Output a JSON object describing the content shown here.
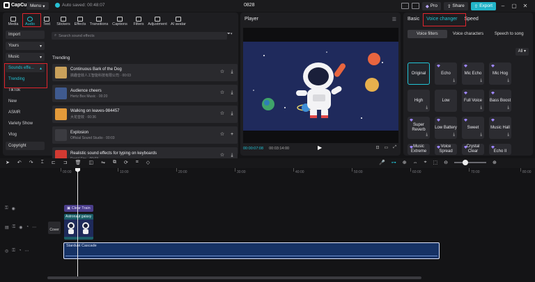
{
  "titlebar": {
    "app_name": "CapCut",
    "menu_label": "Menu",
    "autosave_text": "Auto saved: 00:48:07",
    "project_title": "0828",
    "pro_label": "Pro",
    "share_label": "Share",
    "export_label": "Export"
  },
  "toolbar": {
    "items": [
      {
        "label": "Media",
        "icon": "media-icon"
      },
      {
        "label": "Audio",
        "icon": "audio-icon",
        "active": true
      },
      {
        "label": "Text",
        "icon": "text-icon"
      },
      {
        "label": "Stickers",
        "icon": "sticker-icon"
      },
      {
        "label": "Effects",
        "icon": "effects-icon"
      },
      {
        "label": "Transitions",
        "icon": "transitions-icon"
      },
      {
        "label": "Captions",
        "icon": "captions-icon"
      },
      {
        "label": "Filters",
        "icon": "filters-icon"
      },
      {
        "label": "Adjustment",
        "icon": "adjustment-icon"
      },
      {
        "label": "AI avatar",
        "icon": "ai-avatar-icon"
      }
    ]
  },
  "sidenav": {
    "yours": "Yours",
    "music": "Music",
    "sound_effects": "Sounds effe...",
    "trending": "Trending",
    "tiktok": "TikTok",
    "new": "New",
    "asmr": "ASMR",
    "variety": "Variety Show",
    "vlog": "Vlog",
    "copyright": "Copyright",
    "import": "Import"
  },
  "search": {
    "placeholder": "Search sound effects"
  },
  "section_title": "Trending",
  "sounds": [
    {
      "name": "Continuous Bark of the Dog",
      "meta": "搞趣音效人工智能科技有限公司 · 00:03",
      "color": "#c9a15b"
    },
    {
      "name": "Audience cheers",
      "meta": "Hertz Box Music · 00:20",
      "color": "#3f5a8f"
    },
    {
      "name": "Walking on leaves-984457",
      "meta": "大花音效 · 00:36",
      "color": "#e39a3a"
    },
    {
      "name": "Explosion",
      "meta": "Official Sound Studio · 00:03",
      "color": "#3b3b40"
    },
    {
      "name": "Realistic sound effects for typing on keyboards",
      "meta": "Rapid Fire · 00:03",
      "color": "#d23a32"
    }
  ],
  "player": {
    "title": "Player",
    "current_time": "00:00:07:08",
    "total_time": "00:03:14:00"
  },
  "right_panel": {
    "tabs": [
      "Basic",
      "Voice changer",
      "Speed"
    ],
    "subtabs": [
      "Voice filters",
      "Voice characters",
      "Speech to song"
    ],
    "all_label": "All",
    "voices": [
      {
        "label": "Original",
        "selected": true
      },
      {
        "label": "Echo",
        "pro": true,
        "download": true
      },
      {
        "label": "Mic Echo",
        "pro": true,
        "download": true
      },
      {
        "label": "Mic Hog",
        "pro": true,
        "download": true
      },
      {
        "label": "High",
        "pro": false,
        "download": true
      },
      {
        "label": "Low",
        "pro": false,
        "download": false
      },
      {
        "label": "Full Voice",
        "pro": true,
        "download": true
      },
      {
        "label": "Bass Boost",
        "pro": true,
        "download": true
      },
      {
        "label": "Super Reverb",
        "pro": true,
        "download": true
      },
      {
        "label": "Low Battery",
        "pro": true,
        "download": true
      },
      {
        "label": "Sweet",
        "pro": true,
        "download": true
      },
      {
        "label": "Music Hall",
        "pro": true,
        "download": true
      },
      {
        "label": "Music Extreme",
        "pro": true,
        "download": false
      },
      {
        "label": "Voice Spread",
        "pro": true,
        "download": false
      },
      {
        "label": "Crystal Clear",
        "pro": true,
        "download": false
      },
      {
        "label": "Echo II",
        "pro": true,
        "download": false
      }
    ]
  },
  "timeline": {
    "ruler": [
      "00:00",
      "10:00",
      "20:00",
      "30:00",
      "40:00",
      "50:00",
      "60:00",
      "70:00",
      "80:00"
    ],
    "text_clip": "Clear Train",
    "video_clip": "Astronaut galaxy",
    "cover_label": "Cover",
    "audio_clip": "Stardust Cascade"
  },
  "colors": {
    "accent": "#22c4d6",
    "highlight_box": "#e0242c",
    "panel": "#1e1e21",
    "background": "#141416"
  }
}
